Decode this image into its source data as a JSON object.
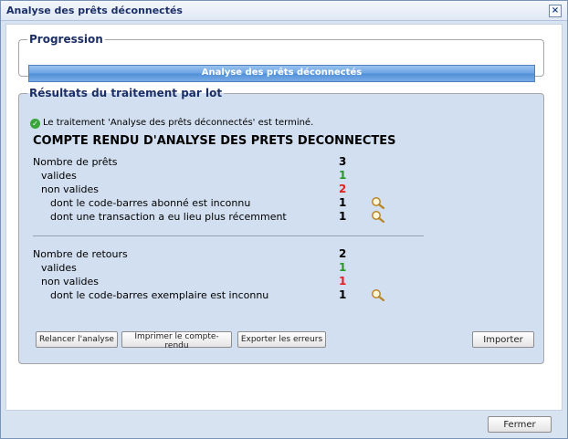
{
  "window": {
    "title": "Analyse des prêts déconnectés",
    "close_glyph": "×"
  },
  "progression": {
    "legend": "Progression",
    "bar_label": "Analyse des prêts déconnectés",
    "progress_fraction": 1.0
  },
  "results": {
    "legend": "Résultats du traitement par lot",
    "status_message": "Le traitement 'Analyse des prêts déconnectés' est terminé.",
    "status_icon": "check-circle-icon",
    "report_title": "COMPTE RENDU D'ANALYSE DES PRETS DECONNECTES",
    "loans": {
      "label": "Nombre de prêts",
      "value": "3",
      "valid_label": "valides",
      "valid_value": "1",
      "invalid_label": "non valides",
      "invalid_value": "2",
      "details": [
        {
          "label": "dont le code-barres abonné est inconnu",
          "value": "1"
        },
        {
          "label": "dont une transaction a eu lieu plus récemment",
          "value": "1"
        }
      ]
    },
    "returns": {
      "label": "Nombre de retours",
      "value": "2",
      "valid_label": "valides",
      "valid_value": "1",
      "invalid_label": "non valides",
      "invalid_value": "1",
      "details": [
        {
          "label": "dont le code-barres exemplaire est inconnu",
          "value": "1"
        }
      ]
    },
    "colors": {
      "valid": "#239b23",
      "invalid": "#e02020"
    }
  },
  "actions": {
    "rerun": "Relancer l'analyse",
    "print": "Imprimer le compte-rendu",
    "export": "Exporter les erreurs",
    "import": "Importer"
  },
  "footer": {
    "close": "Fermer"
  }
}
